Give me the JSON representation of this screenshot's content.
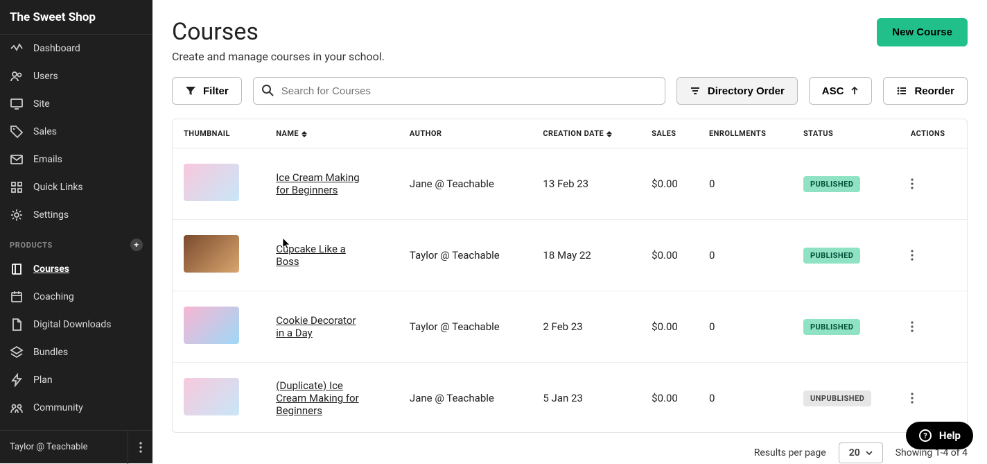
{
  "brand": "The Sweet Shop",
  "sidebar": {
    "main_items": [
      {
        "icon": "activity",
        "label": "Dashboard"
      },
      {
        "icon": "users",
        "label": "Users"
      },
      {
        "icon": "monitor",
        "label": "Site"
      },
      {
        "icon": "tag",
        "label": "Sales"
      },
      {
        "icon": "mail",
        "label": "Emails"
      },
      {
        "icon": "grid",
        "label": "Quick Links"
      },
      {
        "icon": "gear",
        "label": "Settings"
      }
    ],
    "products_header": "PRODUCTS",
    "product_items": [
      {
        "icon": "book",
        "label": "Courses",
        "active": true
      },
      {
        "icon": "calendar",
        "label": "Coaching"
      },
      {
        "icon": "file",
        "label": "Digital Downloads"
      },
      {
        "icon": "layers",
        "label": "Bundles"
      },
      {
        "icon": "bolt",
        "label": "Plan"
      },
      {
        "icon": "community",
        "label": "Community"
      }
    ]
  },
  "user_bar": "Taylor @ Teachable",
  "page": {
    "title": "Courses",
    "subtitle": "Create and manage courses in your school.",
    "new_button": "New Course"
  },
  "toolbar": {
    "filter": "Filter",
    "search_placeholder": "Search for Courses",
    "sort_field": "Directory Order",
    "sort_dir": "ASC",
    "reorder": "Reorder"
  },
  "table": {
    "headers": {
      "thumbnail": "THUMBNAIL",
      "name": "NAME",
      "author": "AUTHOR",
      "creation": "CREATION DATE",
      "sales": "SALES",
      "enrollments": "ENROLLMENTS",
      "status": "STATUS",
      "actions": "ACTIONS"
    },
    "rows": [
      {
        "name": "Ice Cream Making for Beginners",
        "author": "Jane @ Teachable",
        "date": "13 Feb 23",
        "sales": "$0.00",
        "enroll": "0",
        "status": "PUBLISHED",
        "pub": true,
        "tclass": "t1"
      },
      {
        "name": "Cupcake Like a Boss",
        "author": "Taylor @ Teachable",
        "date": "18 May 22",
        "sales": "$0.00",
        "enroll": "0",
        "status": "PUBLISHED",
        "pub": true,
        "tclass": "t2"
      },
      {
        "name": "Cookie Decorator in a Day",
        "author": "Taylor @ Teachable",
        "date": "2 Feb 23",
        "sales": "$0.00",
        "enroll": "0",
        "status": "PUBLISHED",
        "pub": true,
        "tclass": "t3"
      },
      {
        "name": "(Duplicate) Ice Cream Making for Beginners",
        "author": "Jane @ Teachable",
        "date": "5 Jan 23",
        "sales": "$0.00",
        "enroll": "0",
        "status": "UNPUBLISHED",
        "pub": false,
        "tclass": "t1"
      }
    ]
  },
  "pager": {
    "label": "Results per page",
    "per_page": "20",
    "showing": "Showing 1-4 of 4"
  },
  "help_label": "Help"
}
